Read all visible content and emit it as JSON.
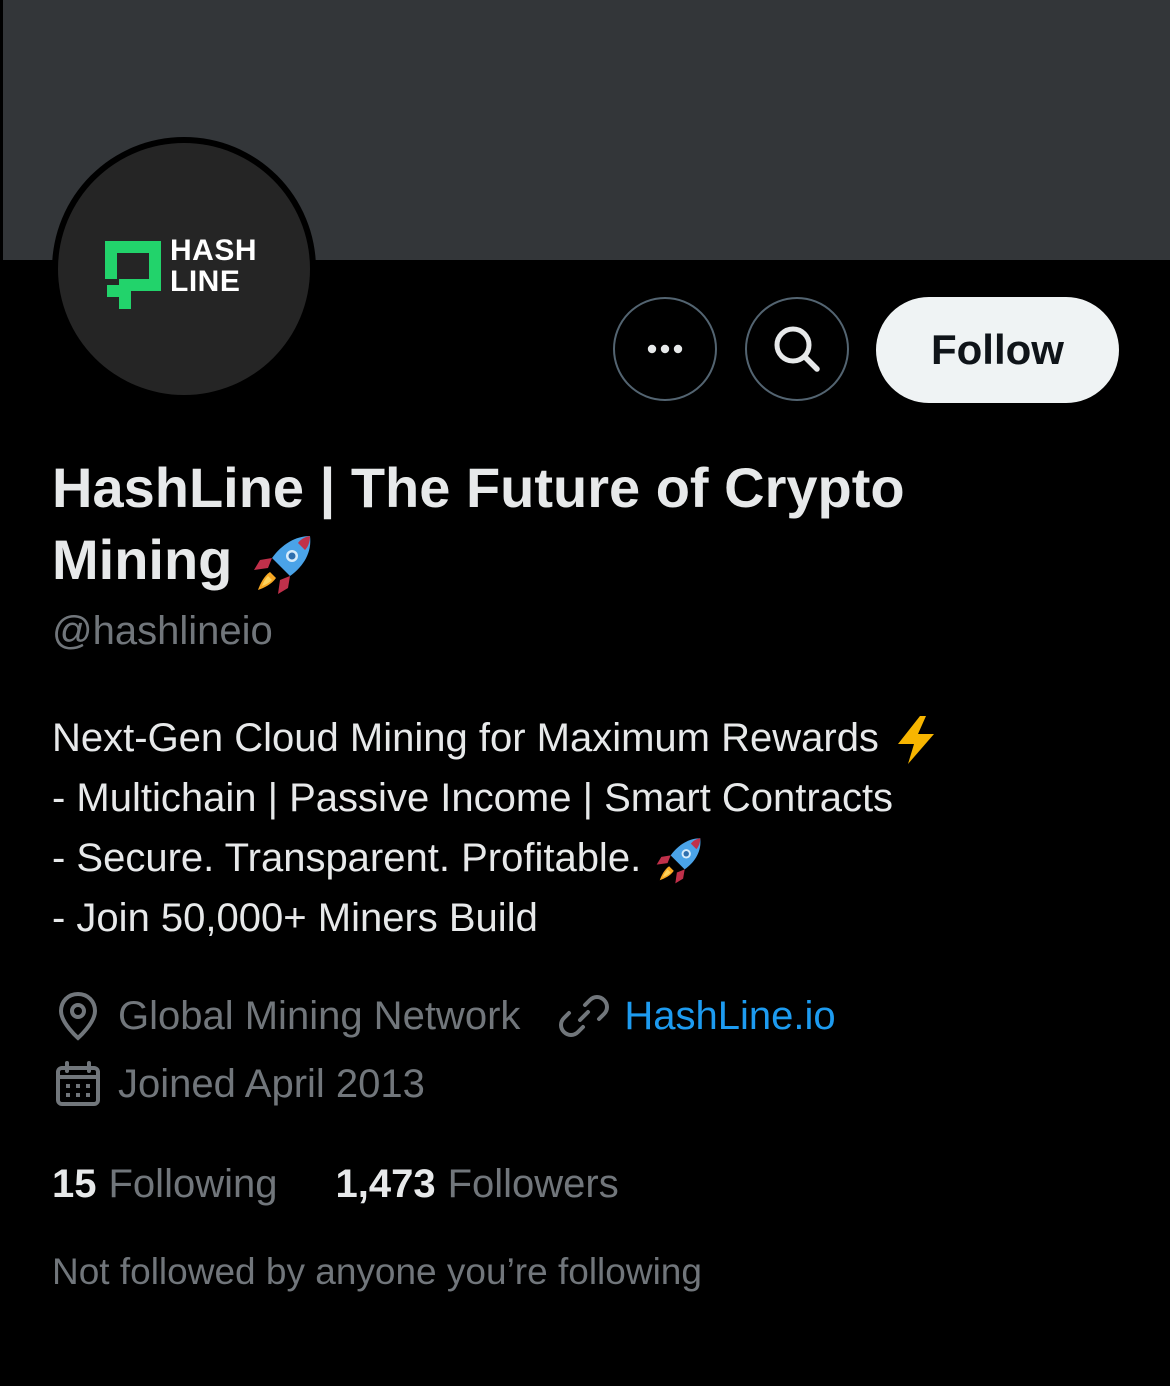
{
  "profile": {
    "display_name": "HashLine | The Future of Crypto Mining",
    "handle": "@hashlineio",
    "avatar_logo_line1": "HASH",
    "avatar_logo_line2": "LINE"
  },
  "actions": {
    "more_icon": "more-horizontal-icon",
    "search_icon": "search-icon",
    "follow_label": "Follow"
  },
  "bio": {
    "line1": "Next-Gen Cloud Mining for Maximum Rewards",
    "line2": "- Multichain | Passive Income | Smart Contracts",
    "line3": "- Secure. Transparent. Profitable.",
    "line4": "- Join 50,000+ Miners Build"
  },
  "meta": {
    "location": "Global Mining Network",
    "website": "HashLine.io",
    "joined": "Joined April 2013"
  },
  "stats": {
    "following_count": "15",
    "following_label": "Following",
    "followers_count": "1,473",
    "followers_label": "Followers"
  },
  "followed_by": "Not followed by anyone you’re following",
  "colors": {
    "background": "#000000",
    "banner": "#333639",
    "primary_text": "#e7e9ea",
    "secondary_text": "#71767b",
    "link": "#1d9bf0",
    "follow_button_bg": "#eff3f4",
    "logo_green": "#22d36b"
  }
}
